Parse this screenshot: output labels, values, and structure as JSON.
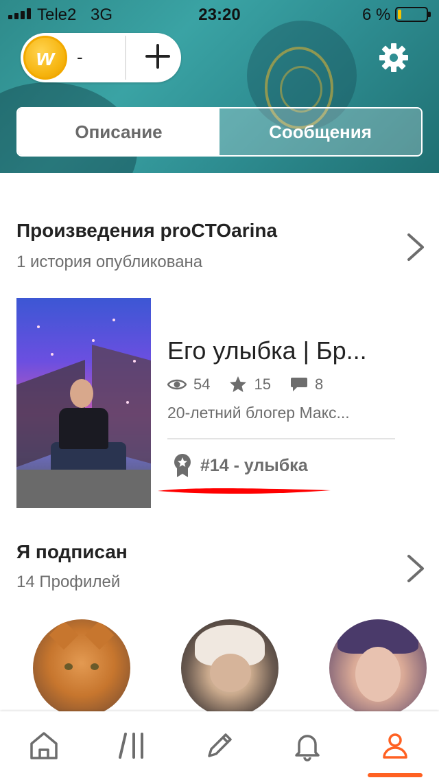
{
  "status_bar": {
    "carrier": "Tele2",
    "network": "3G",
    "time": "23:20",
    "battery_percent": "6 %",
    "battery_level": 0.06,
    "battery_color": "#f5c400"
  },
  "header": {
    "coins_value": "-",
    "coin_icon_letter": "w",
    "add_icon": "plus-icon",
    "settings_icon": "gear-icon"
  },
  "tabs": [
    {
      "label": "Описание",
      "active": true
    },
    {
      "label": "Сообщения",
      "active": false
    }
  ],
  "works": {
    "title": "Произведения",
    "username": "proCTOarina",
    "subtitle": "1 история опубликована",
    "story": {
      "title": "Его улыбка | Бр...",
      "views": "54",
      "votes": "15",
      "comments": "8",
      "description": "20-летний блогер Макс...",
      "rank": "#14 - улыбка"
    }
  },
  "following": {
    "title": "Я подписан",
    "subtitle": "14 Профилей"
  },
  "bottom_nav": [
    {
      "icon": "home-icon",
      "active": false
    },
    {
      "icon": "library-icon",
      "active": false
    },
    {
      "icon": "pencil-icon",
      "active": false
    },
    {
      "icon": "bell-icon",
      "active": false
    },
    {
      "icon": "profile-icon",
      "active": true
    }
  ],
  "colors": {
    "accent": "#ff6122",
    "icon_gray": "#6d6d6d",
    "annotation_red": "#ff0000"
  }
}
